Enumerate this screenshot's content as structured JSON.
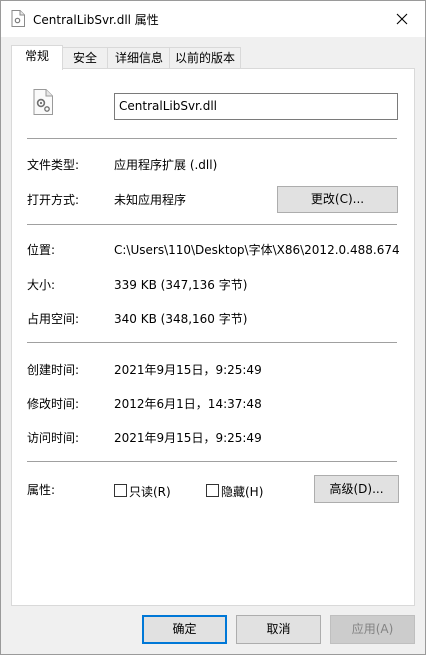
{
  "window": {
    "title": "CentralLibSvr.dll 属性"
  },
  "tabs": [
    "常规",
    "安全",
    "详细信息",
    "以前的版本"
  ],
  "general": {
    "file_name": "CentralLibSvr.dll",
    "file_type_label": "文件类型:",
    "file_type_value": "应用程序扩展 (.dll)",
    "open_with_label": "打开方式:",
    "open_with_value": "未知应用程序",
    "change_button": "更改(C)...",
    "location_label": "位置:",
    "location_value": "C:\\Users\\110\\Desktop\\字体\\X86\\2012.0.488.674",
    "size_label": "大小:",
    "size_value": "339 KB (347,136 字节)",
    "size_on_disk_label": "占用空间:",
    "size_on_disk_value": "340 KB (348,160 字节)",
    "created_label": "创建时间:",
    "created_value": "2021年9月15日，9:25:49",
    "modified_label": "修改时间:",
    "modified_value": "2012年6月1日，14:37:48",
    "accessed_label": "访问时间:",
    "accessed_value": "2021年9月15日，9:25:49",
    "attributes_label": "属性:",
    "readonly_label": "只读(R)",
    "hidden_label": "隐藏(H)",
    "advanced_button": "高级(D)..."
  },
  "footer": {
    "ok": "确定",
    "cancel": "取消",
    "apply": "应用(A)"
  },
  "colors": {
    "accent": "#0078d7",
    "panel": "#ffffff",
    "chrome": "#f0f0f0"
  }
}
